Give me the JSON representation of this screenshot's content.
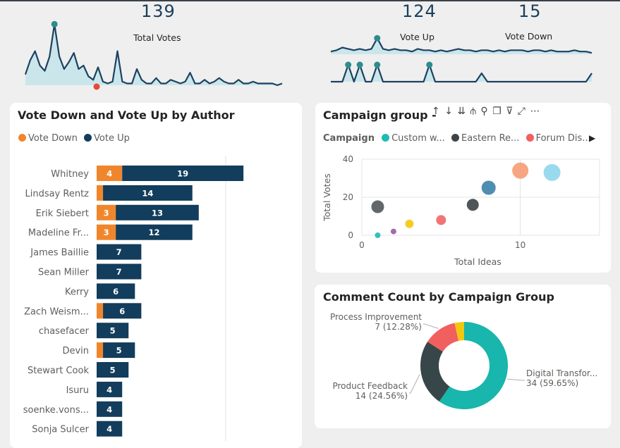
{
  "kpis": {
    "total_votes": {
      "value": "139",
      "label": "Total Votes"
    },
    "vote_up": {
      "value": "124",
      "label": "Vote Up"
    },
    "vote_down": {
      "value": "15",
      "label": "Vote Down"
    }
  },
  "colors": {
    "vote_down": "#f0862c",
    "vote_up": "#123d5c",
    "spark_line": "#1c4260",
    "spark_fill": "#bfe3ea",
    "marker_teal": "#2d8c8c",
    "marker_red": "#e8453c"
  },
  "sparklines": {
    "total": [
      6,
      14,
      19,
      11,
      8,
      16,
      34,
      16,
      9,
      13,
      18,
      9,
      11,
      5,
      3,
      10,
      2,
      1,
      2,
      19,
      2,
      1,
      1,
      9,
      3,
      1,
      1,
      4,
      1,
      1,
      3,
      2,
      1,
      2,
      7,
      1,
      1,
      3,
      1,
      2,
      4,
      2,
      1,
      1,
      3,
      1,
      1,
      2,
      1,
      1,
      1,
      1,
      0,
      1
    ],
    "vote_up": [
      2,
      3,
      5,
      4,
      3,
      4,
      3,
      4,
      12,
      4,
      3,
      4,
      3,
      3,
      2,
      4,
      3,
      3,
      2,
      3,
      2,
      3,
      4,
      3,
      3,
      2,
      3,
      3,
      2,
      3,
      2,
      3,
      3,
      3,
      2,
      3,
      3,
      2,
      3,
      2,
      2,
      2,
      3,
      2,
      2,
      1
    ],
    "vote_down": [
      0,
      0,
      0,
      2,
      0,
      2,
      0,
      0,
      2,
      0,
      0,
      0,
      0,
      0,
      0,
      0,
      0,
      2,
      0,
      0,
      0,
      0,
      0,
      0,
      0,
      0,
      1,
      0,
      0,
      0,
      0,
      0,
      0,
      0,
      0,
      0,
      0,
      0,
      0,
      0,
      0,
      0,
      0,
      0,
      0,
      1
    ]
  },
  "bar_card": {
    "title": "Vote Down and Vote Up by Author",
    "legend": [
      "Vote Down",
      "Vote Up"
    ]
  },
  "scatter_card": {
    "title": "Campaign group -",
    "legend_label": "Campaign",
    "legend_items": [
      {
        "name": "Custom w...",
        "color": "#1fbab0"
      },
      {
        "name": "Eastern Re...",
        "color": "#3c4448"
      },
      {
        "name": "Forum Dis...",
        "color": "#f15f5f"
      }
    ],
    "toolbar_icons": [
      "sort-ascending-icon",
      "sort-descending-icon",
      "drill-down-icon",
      "expand-hierarchy-icon",
      "pin-icon",
      "copy-icon",
      "filter-icon",
      "focus-mode-icon",
      "more-options-icon"
    ]
  },
  "donut_card": {
    "title": "Comment Count by Campaign Group"
  },
  "chart_data": [
    {
      "type": "bar",
      "title": "Vote Down and Vote Up by Author",
      "orientation": "horizontal",
      "stacked": true,
      "categories": [
        "Whitney",
        "Lindsay Rentz",
        "Erik Siebert",
        "Madeline Fr...",
        "James Baillie",
        "Sean Miller",
        "Kerry",
        "Zach Weism...",
        "chasefacer",
        "Devin",
        "Stewart Cook",
        "Isuru",
        "soenke.vons...",
        "Sonja Sulcer"
      ],
      "series": [
        {
          "name": "Vote Down",
          "color": "#f0862c",
          "values": [
            4,
            1,
            3,
            3,
            0,
            0,
            0,
            1,
            0,
            1,
            0,
            0,
            0,
            0
          ],
          "labels": [
            "4",
            "",
            "3",
            "3",
            "",
            "",
            "",
            "",
            "",
            "",
            "",
            "",
            "",
            ""
          ]
        },
        {
          "name": "Vote Up",
          "color": "#123d5c",
          "values": [
            19,
            14,
            13,
            12,
            7,
            7,
            6,
            6,
            5,
            5,
            5,
            4,
            4,
            4
          ],
          "labels": [
            "19",
            "14",
            "13",
            "12",
            "7",
            "7",
            "6",
            "6",
            "5",
            "5",
            "5",
            "4",
            "4",
            "4"
          ]
        }
      ],
      "legend_position": "top-left"
    },
    {
      "type": "scatter",
      "title": "Campaign group -",
      "xlabel": "Total Ideas",
      "ylabel": "Total Votes",
      "xlim": [
        0,
        15
      ],
      "ylim": [
        0,
        40
      ],
      "xticks": [
        "0",
        "10"
      ],
      "yticks": [
        "0",
        "20",
        "40"
      ],
      "points": [
        {
          "x": 1,
          "y": 15,
          "size": 9,
          "color": "#50585c"
        },
        {
          "x": 1,
          "y": 0,
          "size": 4,
          "color": "#1fbab0"
        },
        {
          "x": 2,
          "y": 2,
          "size": 4,
          "color": "#9b59a6"
        },
        {
          "x": 3,
          "y": 6,
          "size": 6,
          "color": "#f2c80f"
        },
        {
          "x": 5,
          "y": 8,
          "size": 7,
          "color": "#ef6666"
        },
        {
          "x": 7,
          "y": 16,
          "size": 8.5,
          "color": "#3c4448"
        },
        {
          "x": 8,
          "y": 25,
          "size": 10,
          "color": "#3b82a8"
        },
        {
          "x": 10,
          "y": 34,
          "size": 11.5,
          "color": "#f59c74"
        },
        {
          "x": 12,
          "y": 33,
          "size": 12,
          "color": "#8fd6ec"
        }
      ]
    },
    {
      "type": "pie",
      "donut": true,
      "title": "Comment Count by Campaign Group",
      "slices": [
        {
          "name": "Digital Transfor...",
          "value": 34,
          "label": "Digital Transfor...",
          "sublabel": "34 (59.65%)",
          "color": "#18b6ac"
        },
        {
          "name": "Product Feedback",
          "value": 14,
          "label": "Product Feedback",
          "sublabel": "14 (24.56%)",
          "color": "#374649"
        },
        {
          "name": "Process Improvement",
          "value": 7,
          "label": "Process Improvement",
          "sublabel": "7 (12.28%)",
          "color": "#f15f5f"
        },
        {
          "name": "",
          "value": 2,
          "label": "",
          "sublabel": "",
          "color": "#f2c80f"
        }
      ]
    }
  ]
}
